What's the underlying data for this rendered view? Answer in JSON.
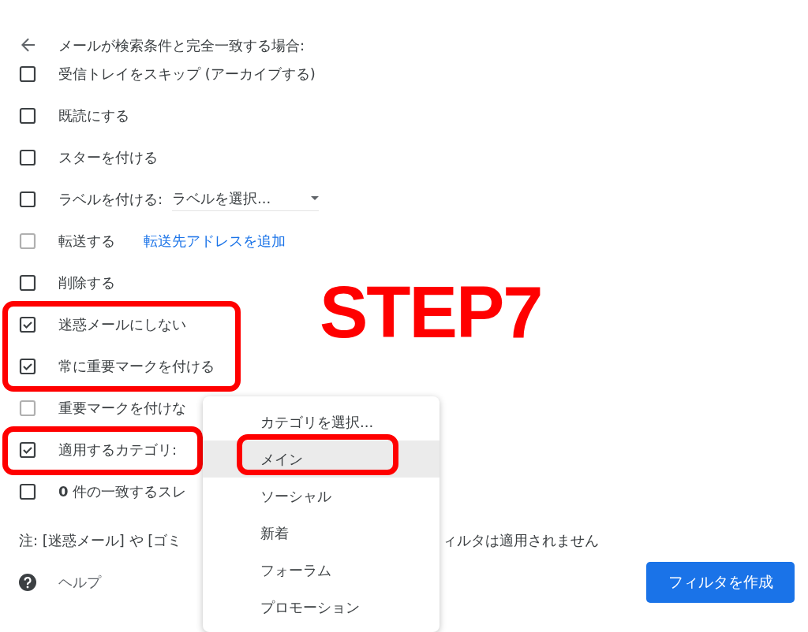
{
  "header": {
    "title": "メールが検索条件と完全一致する場合:"
  },
  "options": [
    {
      "kind": "checkbox",
      "label": "受信トレイをスキップ (アーカイブする)",
      "checked": false,
      "disabled": false,
      "highlighted": false
    },
    {
      "kind": "checkbox",
      "label": "既読にする",
      "checked": false,
      "disabled": false,
      "highlighted": false
    },
    {
      "kind": "checkbox",
      "label": "スターを付ける",
      "checked": false,
      "disabled": false,
      "highlighted": false
    },
    {
      "kind": "select",
      "label": "ラベルを付ける:",
      "value": "ラベルを選択...",
      "checked": false,
      "disabled": false,
      "highlighted": false
    },
    {
      "kind": "link",
      "label": "転送する",
      "link": "転送先アドレスを追加",
      "checked": false,
      "disabled": true,
      "highlighted": false
    },
    {
      "kind": "checkbox",
      "label": "削除する",
      "checked": false,
      "disabled": false,
      "highlighted": false
    },
    {
      "kind": "checkbox",
      "label": "迷惑メールにしない",
      "checked": true,
      "disabled": false,
      "highlighted": true
    },
    {
      "kind": "checkbox",
      "label": "常に重要マークを付ける",
      "checked": true,
      "disabled": false,
      "highlighted": true
    },
    {
      "kind": "checkbox",
      "label": "重要マークを付けな",
      "checked": false,
      "disabled": true,
      "highlighted": false
    },
    {
      "kind": "checkbox",
      "label": "適用するカテゴリ:",
      "checked": true,
      "disabled": false,
      "highlighted": true
    },
    {
      "kind": "checkbox",
      "label": "**0** 件の一致するスレ",
      "checked": false,
      "disabled": false,
      "highlighted": false
    }
  ],
  "note": {
    "left": "注: [迷惑メール] や [ゴミ",
    "right": "ィルタは適用されません"
  },
  "help": {
    "label": "ヘルプ"
  },
  "create_button": "フィルタを作成",
  "category_menu": [
    {
      "label": "カテゴリを選択...",
      "selected": false,
      "highlighted": false
    },
    {
      "label": "メイン",
      "selected": true,
      "highlighted": true
    },
    {
      "label": "ソーシャル",
      "selected": false,
      "highlighted": false
    },
    {
      "label": "新着",
      "selected": false,
      "highlighted": false
    },
    {
      "label": "フォーラム",
      "selected": false,
      "highlighted": false
    },
    {
      "label": "プロモーション",
      "selected": false,
      "highlighted": false
    }
  ],
  "annotation": {
    "text": "STEP7"
  }
}
